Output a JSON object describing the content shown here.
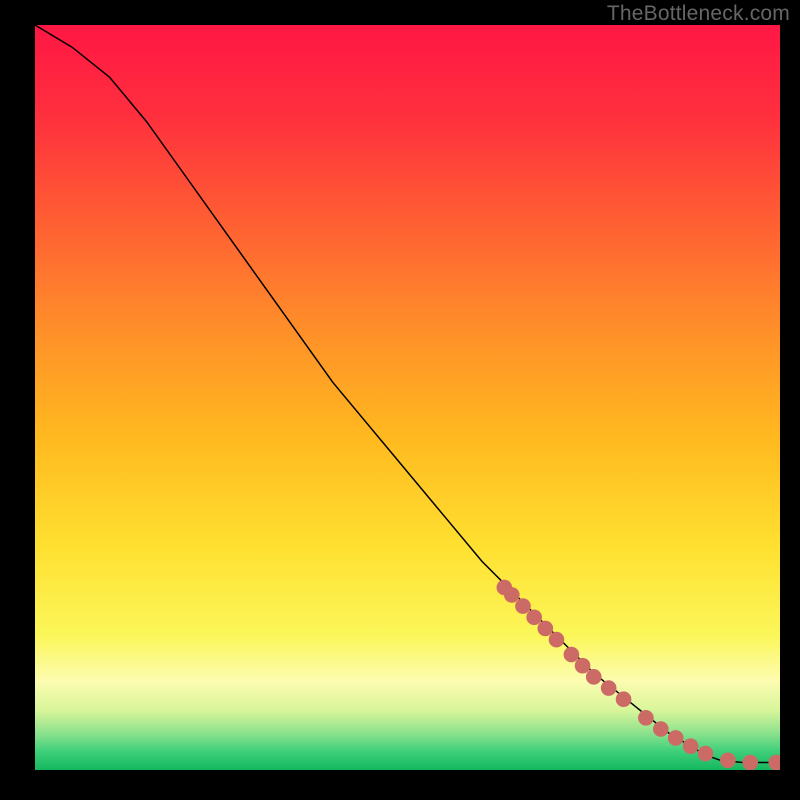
{
  "watermark": "TheBottleneck.com",
  "chart_data": {
    "type": "line",
    "title": "",
    "xlabel": "",
    "ylabel": "",
    "xlim": [
      0,
      100
    ],
    "ylim": [
      0,
      100
    ],
    "grid": false,
    "legend": null,
    "annotations": [],
    "series": [
      {
        "name": "curve",
        "x": [
          0,
          5,
          10,
          15,
          20,
          25,
          30,
          35,
          40,
          45,
          50,
          55,
          60,
          65,
          70,
          75,
          80,
          85,
          90,
          92,
          95,
          100
        ],
        "y": [
          100,
          97,
          93,
          87,
          80,
          73,
          66,
          59,
          52,
          46,
          40,
          34,
          28,
          23,
          18,
          13,
          9,
          5,
          2,
          1.3,
          1,
          1
        ],
        "color": "#000000"
      },
      {
        "name": "marker-dots",
        "type": "scatter",
        "x": [
          63,
          64,
          65.5,
          67,
          68.5,
          70,
          72,
          73.5,
          75,
          77,
          79,
          82,
          84,
          86,
          88,
          90,
          93,
          96,
          99.5
        ],
        "y": [
          24.5,
          23.5,
          22,
          20.5,
          19,
          17.5,
          15.5,
          14,
          12.5,
          11,
          9.5,
          7,
          5.5,
          4.3,
          3.2,
          2.2,
          1.3,
          1,
          1
        ],
        "color": "#cc6b66"
      }
    ],
    "background_gradient": {
      "stops": [
        {
          "pos": 0.0,
          "color": "#ff1744"
        },
        {
          "pos": 0.12,
          "color": "#ff2f3e"
        },
        {
          "pos": 0.25,
          "color": "#ff5a34"
        },
        {
          "pos": 0.4,
          "color": "#ff8c2a"
        },
        {
          "pos": 0.55,
          "color": "#ffb81f"
        },
        {
          "pos": 0.7,
          "color": "#ffe030"
        },
        {
          "pos": 0.82,
          "color": "#fbf75a"
        },
        {
          "pos": 0.88,
          "color": "#fdfcb0"
        },
        {
          "pos": 0.92,
          "color": "#d8f59a"
        },
        {
          "pos": 0.95,
          "color": "#8ee28d"
        },
        {
          "pos": 0.975,
          "color": "#3ecf7a"
        },
        {
          "pos": 1.0,
          "color": "#14b85f"
        }
      ]
    }
  }
}
